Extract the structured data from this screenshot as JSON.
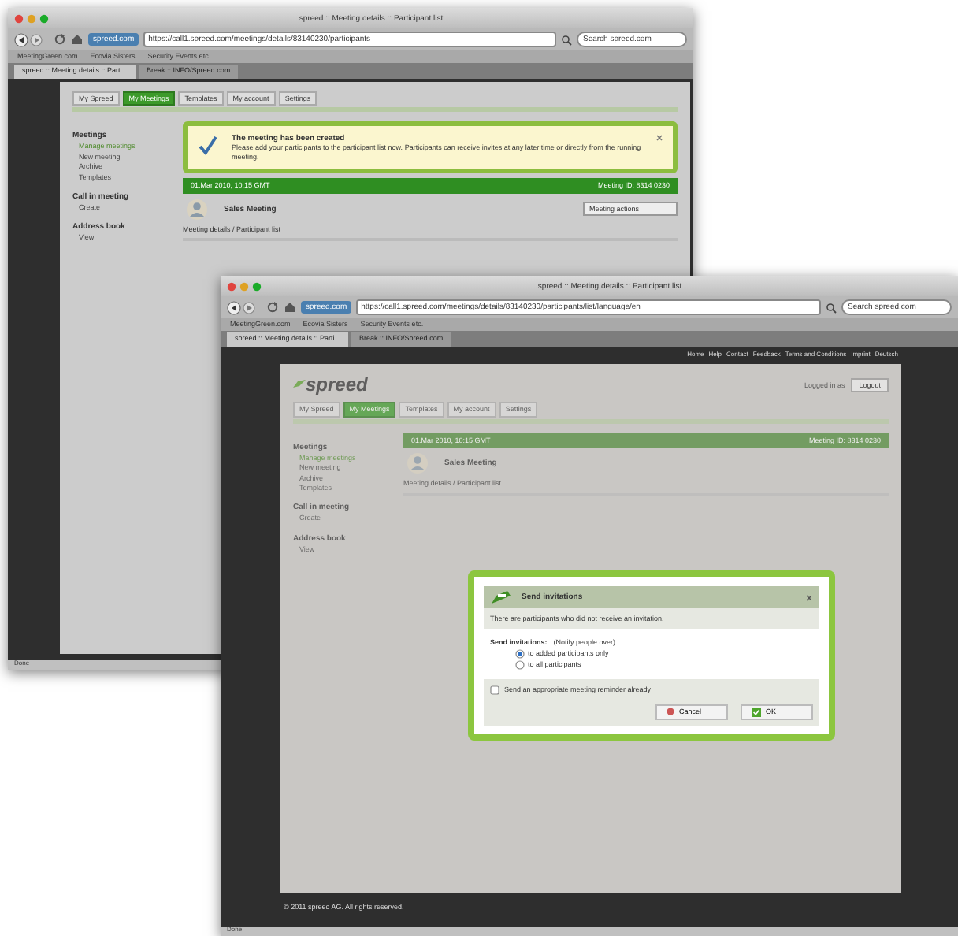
{
  "windows": [
    {
      "title": "spreed :: Meeting details :: Participant list",
      "identity": "spreed.com",
      "address": "https://call1.spreed.com/meetings/details/83140230/participants",
      "search": "Search spreed.com",
      "bookmarks": [
        "MeetingGreen.com",
        "Ecovia Sisters",
        "Security Events etc."
      ],
      "tabs": [
        {
          "label": "spreed :: Meeting details :: Parti...",
          "selected": true
        },
        {
          "label": "Break :: INFO/Spreed.com",
          "selected": false
        }
      ],
      "nav_tabs": [
        {
          "label": "My Spreed",
          "selected": false
        },
        {
          "label": "My Meetings",
          "selected": true
        },
        {
          "label": "Templates",
          "selected": false
        },
        {
          "label": "My account",
          "selected": false
        },
        {
          "label": "Settings",
          "selected": false
        }
      ],
      "sidebar": [
        {
          "heading": "Meetings",
          "items": [
            {
              "label": "Manage meetings",
              "selected": true
            },
            {
              "label": "New meeting",
              "selected": false
            },
            {
              "label": "Archive",
              "selected": false
            },
            {
              "label": "Templates",
              "selected": false
            }
          ]
        },
        {
          "heading": "Call in meeting",
          "items": [
            {
              "label": "Create",
              "selected": false
            }
          ]
        },
        {
          "heading": "Address book",
          "items": [
            {
              "label": "View",
              "selected": false
            }
          ]
        }
      ],
      "notice": {
        "title": "The meeting has been created",
        "text": "Please add your participants to the participant list now. Participants can receive invites at any later time or directly from the running meeting."
      },
      "meeting": {
        "date": "01.Mar 2010, 10:15 GMT",
        "id": "Meeting ID: 8314 0230",
        "name": "Sales Meeting",
        "actions": "Meeting actions"
      },
      "breadcrumb": "Meeting details / Participant list",
      "status": "Done"
    },
    {
      "title": "spreed :: Meeting details :: Participant list",
      "identity": "spreed.com",
      "address": "https://call1.spreed.com/meetings/details/83140230/participants/list/language/en",
      "search": "Search spreed.com",
      "bookmarks": [
        "MeetingGreen.com",
        "Ecovia Sisters",
        "Security Events etc."
      ],
      "tabs": [
        {
          "label": "spreed :: Meeting details :: Parti...",
          "selected": true
        },
        {
          "label": "Break :: INFO/Spreed.com",
          "selected": false
        }
      ],
      "top_links": [
        "Home",
        "Help",
        "Contact",
        "Feedback",
        "Terms and Conditions",
        "Imprint",
        "Deutsch"
      ],
      "logo": "spreed",
      "user": "Logged in as",
      "logout": "Logout",
      "nav_tabs": [
        {
          "label": "My Spreed",
          "selected": false
        },
        {
          "label": "My Meetings",
          "selected": true
        },
        {
          "label": "Templates",
          "selected": false
        },
        {
          "label": "My account",
          "selected": false
        },
        {
          "label": "Settings",
          "selected": false
        }
      ],
      "sidebar": [
        {
          "heading": "Meetings",
          "items": [
            {
              "label": "Manage meetings",
              "selected": true
            },
            {
              "label": "New meeting",
              "selected": false
            },
            {
              "label": "Archive",
              "selected": false
            },
            {
              "label": "Templates",
              "selected": false
            }
          ]
        },
        {
          "heading": "Call in meeting",
          "items": [
            {
              "label": "Create",
              "selected": false
            }
          ]
        },
        {
          "heading": "Address book",
          "items": [
            {
              "label": "View",
              "selected": false
            }
          ]
        }
      ],
      "meeting": {
        "date": "01.Mar 2010, 10:15 GMT",
        "id": "Meeting ID: 8314 0230",
        "name": "Sales Meeting"
      },
      "breadcrumb": "Meeting details / Participant list",
      "dialog": {
        "title": "Send invitations",
        "message": "There are participants who did not receive an invitation.",
        "label": "Send invitations:",
        "hint": "(Notify people over)",
        "options": [
          {
            "label": "to added participants only",
            "selected": true
          },
          {
            "label": "to all participants",
            "selected": false
          }
        ],
        "reminder": {
          "label": "Send an appropriate meeting reminder already",
          "checked": false
        },
        "cancel": "Cancel",
        "ok": "OK"
      },
      "footer": "© 2011 spreed AG. All rights reserved.",
      "status": "Done"
    }
  ]
}
